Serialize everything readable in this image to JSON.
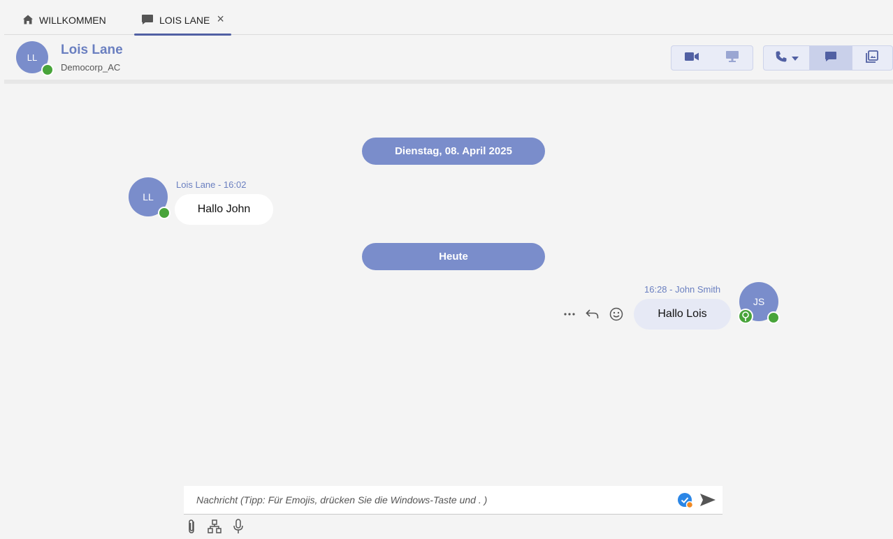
{
  "tabs": [
    {
      "label": "WILLKOMMEN",
      "icon": "home-icon",
      "active": false
    },
    {
      "label": "LOIS LANE",
      "icon": "chat-bubble-icon",
      "active": true,
      "closable": true
    }
  ],
  "header": {
    "avatar_initials": "LL",
    "name": "Lois Lane",
    "organization": "Democorp_AC",
    "status": "online",
    "buttons": [
      "video-call-icon",
      "screen-share-icon",
      "phone-icon",
      "chat-icon",
      "whiteboard-icon"
    ]
  },
  "chat": {
    "date_separators": [
      "Dienstag, 08. April 2025",
      "Heute"
    ],
    "messages": [
      {
        "sender": "Lois Lane",
        "time": "16:02",
        "meta": "Lois Lane - 16:02",
        "text": "Hallo John",
        "avatar_initials": "LL",
        "direction": "incoming"
      },
      {
        "sender": "John Smith",
        "time": "16:28",
        "meta": "16:28 - John Smith",
        "text": "Hallo Lois",
        "avatar_initials": "JS",
        "direction": "outgoing"
      }
    ],
    "message_actions": [
      "more-icon",
      "reply-icon",
      "emoji-icon"
    ]
  },
  "composer": {
    "placeholder": "Nachricht (Tipp: Für Emojis, drücken Sie die Windows-Taste und . )",
    "tools": [
      "attachment-icon",
      "structure-icon",
      "microphone-icon"
    ]
  },
  "colors": {
    "accent": "#7a8dcb",
    "accent_text": "#6a7fc0",
    "tab_underline": "#5160a3",
    "presence_online": "#48a43a",
    "background": "#f4f4f4",
    "outgoing_bubble": "#e6e9f5"
  }
}
